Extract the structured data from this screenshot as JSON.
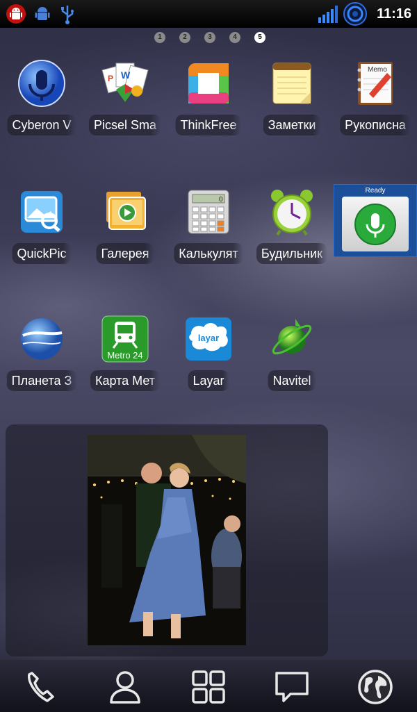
{
  "status_bar": {
    "time": "11:16",
    "icons": [
      "android-debug-icon",
      "android-icon",
      "usb-icon",
      "signal-icon",
      "wimax-icon"
    ]
  },
  "pages": {
    "labels": [
      "1",
      "2",
      "3",
      "4",
      "5"
    ],
    "active": "5"
  },
  "apps": [
    {
      "label": "Cyberon V",
      "icon": "microphone-headset-icon"
    },
    {
      "label": "Picsel Sma",
      "icon": "office-docs-icon"
    },
    {
      "label": "ThinkFree",
      "icon": "thinkfree-icon"
    },
    {
      "label": "Заметки",
      "icon": "notepad-icon"
    },
    {
      "label": "Рукописна",
      "icon": "memo-icon"
    },
    {
      "label": "QuickPic",
      "icon": "quickpic-icon"
    },
    {
      "label": "Галерея",
      "icon": "gallery-icon"
    },
    {
      "label": "Калькулят",
      "icon": "calculator-icon"
    },
    {
      "label": "Будильник",
      "icon": "alarm-clock-icon"
    },
    {
      "label": "Планета З",
      "icon": "google-earth-icon"
    },
    {
      "label": "Карта Мет",
      "icon": "metro-icon"
    },
    {
      "label": "Layar",
      "icon": "layar-icon"
    },
    {
      "label": "Navitel",
      "icon": "navitel-icon"
    }
  ],
  "metro_badge": "Metro 24",
  "layar_badge": "layar",
  "memo_badge": "Memo",
  "calculator_display": "0",
  "voice_widget": {
    "status": "Ready",
    "icon": "microphone-icon"
  },
  "dock": [
    {
      "icon": "phone-icon"
    },
    {
      "icon": "contacts-icon"
    },
    {
      "icon": "app-grid-icon"
    },
    {
      "icon": "messages-icon"
    },
    {
      "icon": "globe-icon"
    }
  ]
}
